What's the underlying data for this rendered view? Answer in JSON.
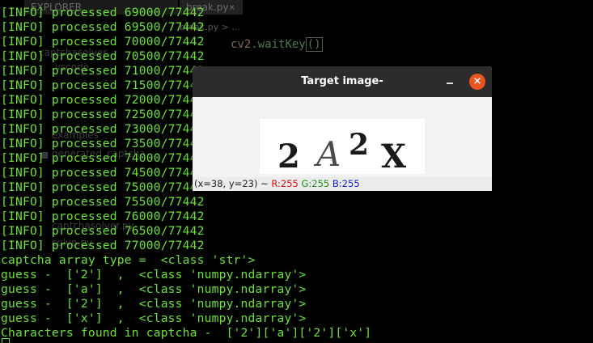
{
  "background_editor": {
    "tab_1": "EXPLORER",
    "tab_2": "break.py",
    "tab_close": "×",
    "breadcrumb": "break.py > ...",
    "code_fn": "cv2",
    "code_call": ".waitKey",
    "code_paren": "()",
    "tree": [
      "captchasolver",
      ".vscode",
      "examples",
      "generated_captcha",
      "captchasolver.py",
      "solve.py"
    ]
  },
  "terminal": {
    "lines": [
      "[INFO] processed 69000/77442",
      "[INFO] processed 69500/77442",
      "[INFO] processed 70000/77442",
      "[INFO] processed 70500/77442",
      "[INFO] processed 71000/77442",
      "[INFO] processed 71500/77442",
      "[INFO] processed 72000/77442",
      "[INFO] processed 72500/77442",
      "[INFO] processed 73000/77442",
      "[INFO] processed 73500/77442",
      "[INFO] processed 74000/77442",
      "[INFO] processed 74500/77442",
      "[INFO] processed 75000/77442",
      "[INFO] processed 75500/77442",
      "[INFO] processed 76000/77442",
      "[INFO] processed 76500/77442",
      "[INFO] processed 77000/77442",
      "captcha array type =  <class 'str'>",
      "guess -  ['2']  ,  <class 'numpy.ndarray'>",
      "guess -  ['a']  ,  <class 'numpy.ndarray'>",
      "guess -  ['2']  ,  <class 'numpy.ndarray'>",
      "guess -  ['x']  ,  <class 'numpy.ndarray'>",
      "Characters found in captcha -  ['2']['a']['2']['x']"
    ],
    "text_color": "#6be234"
  },
  "image_window": {
    "title": "Target image-",
    "minimize_symbol": "",
    "close_symbol": "×",
    "captcha_glyphs": [
      "2",
      "A",
      "2",
      "X"
    ],
    "status": {
      "coords": "(x=38, y=23) ~ ",
      "r": "R:255",
      "g": "G:255",
      "b": "B:255"
    },
    "close_color": "#e9541f"
  }
}
